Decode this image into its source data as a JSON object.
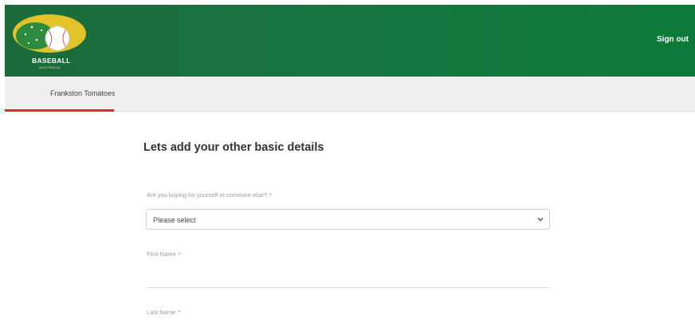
{
  "header": {
    "logo_text": "BASEBALL",
    "logo_subtext": "AUSTRALIA",
    "signout_label": "Sign out",
    "brand_color": "#17753e"
  },
  "subnav": {
    "tabs": [
      {
        "label": "Frankston Tomatoes",
        "active": true
      }
    ],
    "active_color": "#d92b2b"
  },
  "form": {
    "title": "Lets add your other basic details",
    "buyer_question": {
      "label": "Are you buying for yourself or someone else?",
      "required_marker": "*",
      "selected": "Please select",
      "icon": "chevron-down-icon"
    },
    "first_name": {
      "label": "First Name",
      "required_marker": "*",
      "value": ""
    },
    "last_name": {
      "label": "Last Name",
      "required_marker": "*",
      "value": ""
    }
  }
}
